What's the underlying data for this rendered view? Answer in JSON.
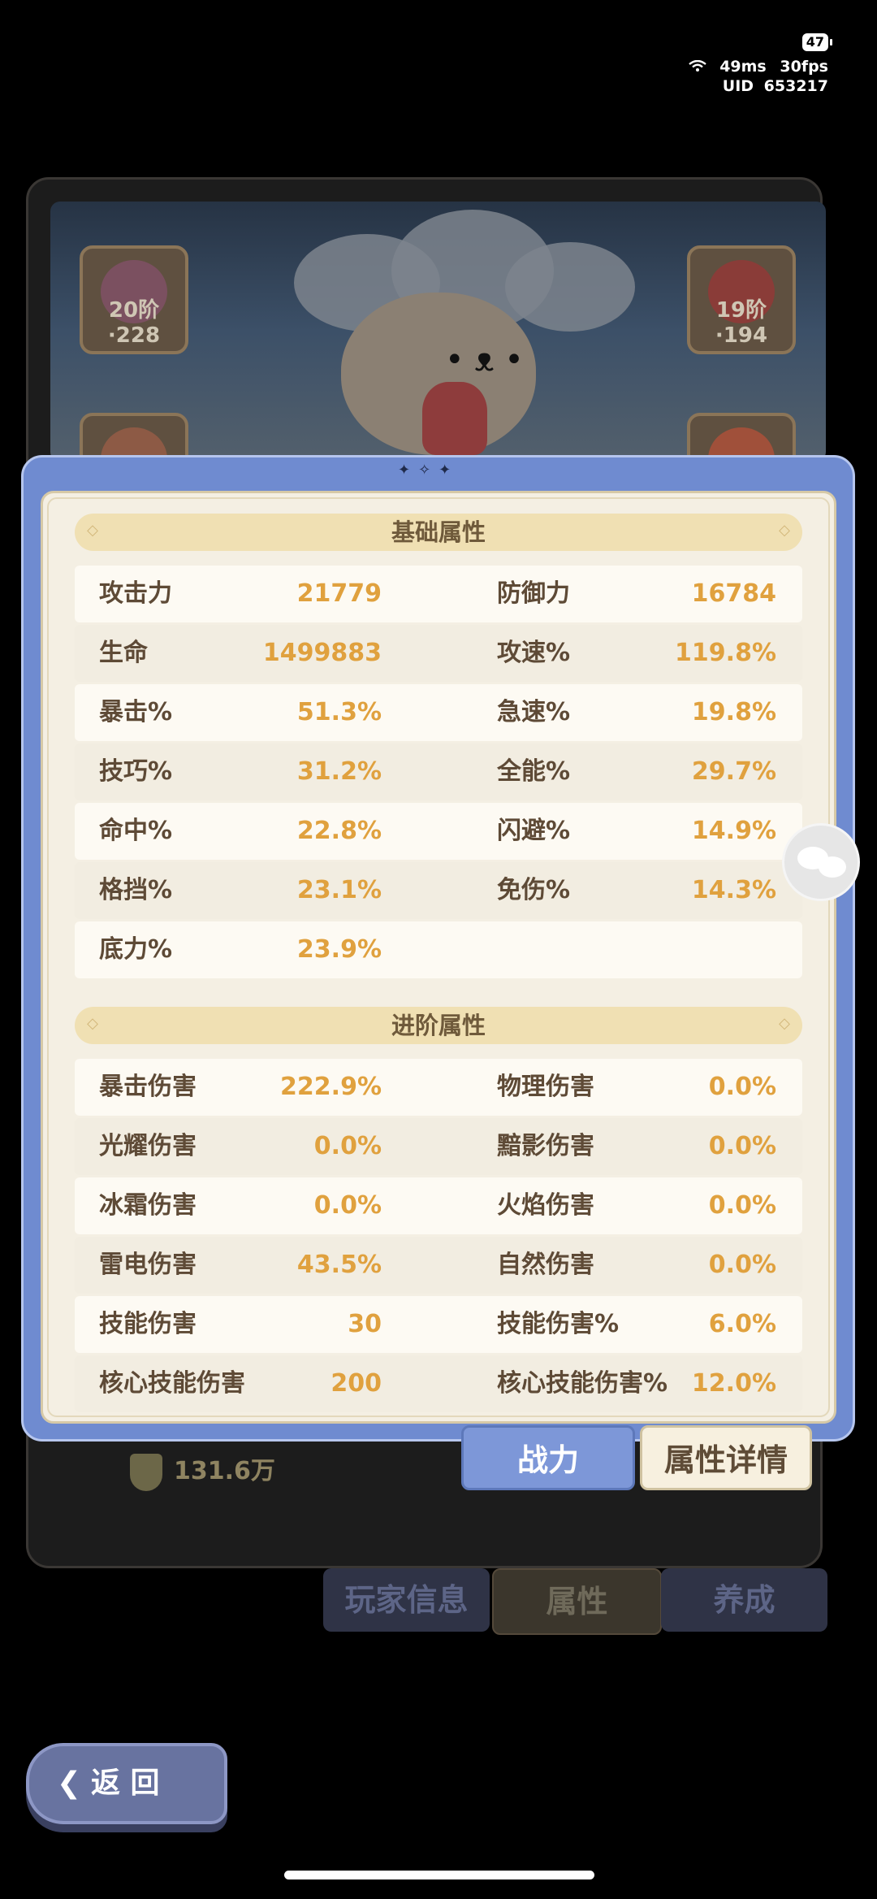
{
  "status": {
    "battery": "47",
    "ping": "49ms",
    "fps": "30fps",
    "uid_label": "UID",
    "uid": "653217"
  },
  "gear": {
    "left_top_level": "20阶·228",
    "right_top_level": "19阶·194"
  },
  "modal": {
    "basic_title": "基础属性",
    "basic_rows": [
      {
        "l1": "攻击力",
        "v1": "21779",
        "l2": "防御力",
        "v2": "16784"
      },
      {
        "l1": "生命",
        "v1": "1499883",
        "l2": "攻速%",
        "v2": "119.8%"
      },
      {
        "l1": "暴击%",
        "v1": "51.3%",
        "l2": "急速%",
        "v2": "19.8%"
      },
      {
        "l1": "技巧%",
        "v1": "31.2%",
        "l2": "全能%",
        "v2": "29.7%"
      },
      {
        "l1": "命中%",
        "v1": "22.8%",
        "l2": "闪避%",
        "v2": "14.9%"
      },
      {
        "l1": "格挡%",
        "v1": "23.1%",
        "l2": "免伤%",
        "v2": "14.3%"
      },
      {
        "l1": "底力%",
        "v1": "23.9%",
        "l2": "",
        "v2": ""
      }
    ],
    "advanced_title": "进阶属性",
    "advanced_rows": [
      {
        "l1": "暴击伤害",
        "v1": "222.9%",
        "l2": "物理伤害",
        "v2": "0.0%"
      },
      {
        "l1": "光耀伤害",
        "v1": "0.0%",
        "l2": "黯影伤害",
        "v2": "0.0%"
      },
      {
        "l1": "冰霜伤害",
        "v1": "0.0%",
        "l2": "火焰伤害",
        "v2": "0.0%"
      },
      {
        "l1": "雷电伤害",
        "v1": "43.5%",
        "l2": "自然伤害",
        "v2": "0.0%"
      },
      {
        "l1": "技能伤害",
        "v1": "30",
        "l2": "技能伤害%",
        "v2": "6.0%"
      },
      {
        "l1": "核心技能伤害",
        "v1": "200",
        "l2": "核心技能伤害%",
        "v2": "12.0%"
      }
    ],
    "btn_power": "战力",
    "btn_detail": "属性详情"
  },
  "power_value": "131.6万",
  "tabs": {
    "player_info": "玩家信息",
    "attributes": "属性",
    "nurture": "养成"
  },
  "back_label": "返 回"
}
